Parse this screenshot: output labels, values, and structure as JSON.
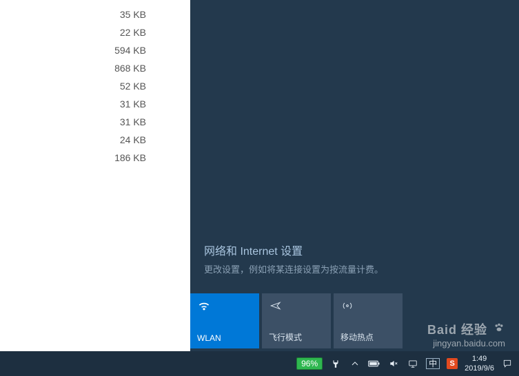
{
  "files": [
    "35 KB",
    "22 KB",
    "594 KB",
    "868 KB",
    "52 KB",
    "31 KB",
    "31 KB",
    "24 KB",
    "186 KB"
  ],
  "network": {
    "title": "网络和 Internet 设置",
    "subtitle": "更改设置，例如将某连接设置为按流量计费。",
    "tiles": {
      "wlan": "WLAN",
      "airplane": "飞行模式",
      "hotspot": "移动热点"
    }
  },
  "tray": {
    "battery_percent": "96%",
    "ime": "中",
    "sogou": "S",
    "time": "1:49",
    "date": "2019/9/6"
  },
  "watermark": {
    "brand": "Baid 经验",
    "url": "jingyan.baidu.com"
  }
}
